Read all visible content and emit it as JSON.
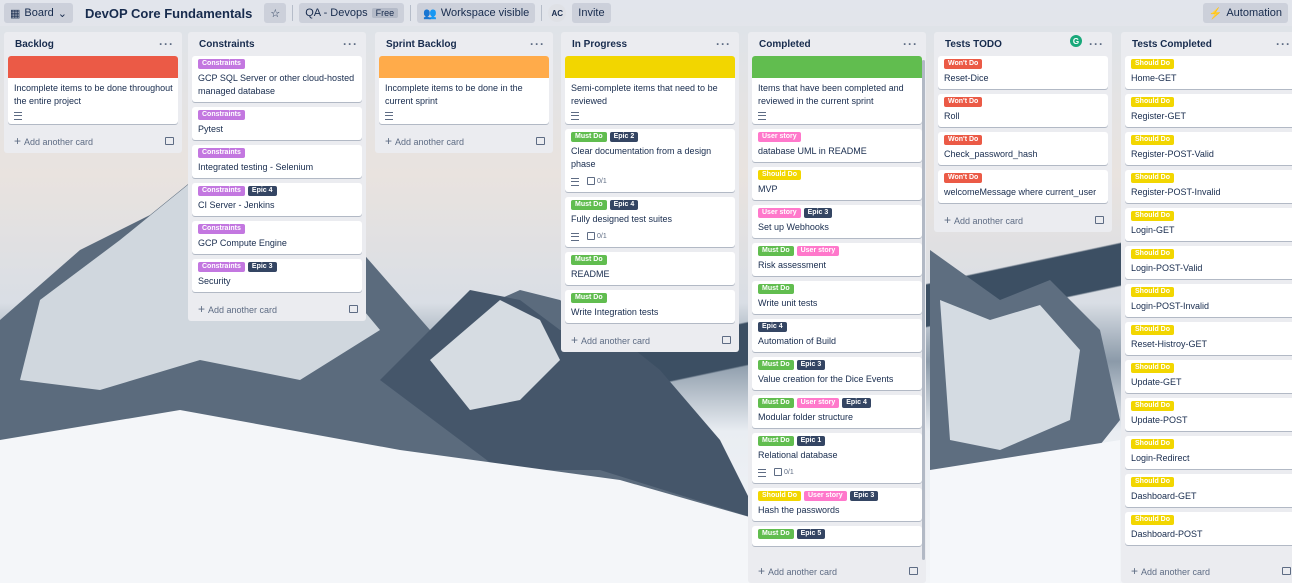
{
  "topbar": {
    "view_label": "Board",
    "board_title": "DevOP Core Fundamentals",
    "workspace_name": "QA - Devops",
    "plan_badge": "Free",
    "visibility_label": "Workspace visible",
    "member_initials": "AC",
    "invite_label": "Invite",
    "automation_label": "Automation"
  },
  "colors": {
    "green": "#61bd4f",
    "yellow": "#f2d600",
    "orange": "#ffab4a",
    "red": "#eb5a46",
    "purple": "#c377e0",
    "pink": "#ff78cb",
    "navy": "#344563"
  },
  "add_card_label": "Add another card",
  "lists": [
    {
      "title": "Backlog",
      "cards": [
        {
          "cover": "red",
          "title": "Incomplete items to be done throughout the entire project",
          "description": true
        }
      ]
    },
    {
      "title": "Constraints",
      "cards": [
        {
          "labels": [
            {
              "text": "Constraints",
              "color": "purple"
            }
          ],
          "title": "GCP SQL Server or other cloud-hosted managed database"
        },
        {
          "labels": [
            {
              "text": "Constraints",
              "color": "purple"
            }
          ],
          "title": "Pytest"
        },
        {
          "labels": [
            {
              "text": "Constraints",
              "color": "purple"
            }
          ],
          "title": "Integrated testing - Selenium"
        },
        {
          "labels": [
            {
              "text": "Constraints",
              "color": "purple"
            },
            {
              "text": "Epic 4",
              "color": "navy"
            }
          ],
          "title": "CI Server - Jenkins"
        },
        {
          "labels": [
            {
              "text": "Constraints",
              "color": "purple"
            }
          ],
          "title": "GCP Compute Engine"
        },
        {
          "labels": [
            {
              "text": "Constraints",
              "color": "purple"
            },
            {
              "text": "Epic 3",
              "color": "navy"
            }
          ],
          "title": "Security"
        }
      ]
    },
    {
      "title": "Sprint Backlog",
      "cards": [
        {
          "cover": "orange",
          "title": "Incomplete items to be done in the current sprint",
          "description": true
        }
      ]
    },
    {
      "title": "In Progress",
      "cards": [
        {
          "cover": "yellow",
          "title": "Semi-complete items that need to be reviewed",
          "description": true
        },
        {
          "labels": [
            {
              "text": "Must Do",
              "color": "green"
            },
            {
              "text": "Epic 2",
              "color": "navy"
            }
          ],
          "title": "Clear documentation from a design phase",
          "description": true,
          "checklist": "0/1"
        },
        {
          "labels": [
            {
              "text": "Must Do",
              "color": "green"
            },
            {
              "text": "Epic 4",
              "color": "navy"
            }
          ],
          "title": "Fully designed test suites",
          "description": true,
          "checklist": "0/1"
        },
        {
          "labels": [
            {
              "text": "Must Do",
              "color": "green"
            }
          ],
          "title": "README"
        },
        {
          "labels": [
            {
              "text": "Must Do",
              "color": "green"
            }
          ],
          "title": "Write Integration tests"
        }
      ]
    },
    {
      "title": "Completed",
      "cards": [
        {
          "cover": "green",
          "title": "Items that have been completed and reviewed in the current sprint",
          "description": true
        },
        {
          "labels": [
            {
              "text": "User story",
              "color": "pink"
            }
          ],
          "title": "database UML in README"
        },
        {
          "labels": [
            {
              "text": "Should Do",
              "color": "yellow"
            }
          ],
          "title": "MVP"
        },
        {
          "labels": [
            {
              "text": "User story",
              "color": "pink"
            },
            {
              "text": "Epic 3",
              "color": "navy"
            }
          ],
          "title": "Set up Webhooks"
        },
        {
          "labels": [
            {
              "text": "Must Do",
              "color": "green"
            },
            {
              "text": "User story",
              "color": "pink"
            }
          ],
          "title": "Risk assessment"
        },
        {
          "labels": [
            {
              "text": "Must Do",
              "color": "green"
            }
          ],
          "title": "Write unit tests"
        },
        {
          "labels": [
            {
              "text": "Epic 4",
              "color": "navy"
            }
          ],
          "title": "Automation of Build"
        },
        {
          "labels": [
            {
              "text": "Must Do",
              "color": "green"
            },
            {
              "text": "Epic 3",
              "color": "navy"
            }
          ],
          "title": "Value creation for the Dice Events"
        },
        {
          "labels": [
            {
              "text": "Must Do",
              "color": "green"
            },
            {
              "text": "User story",
              "color": "pink"
            },
            {
              "text": "Epic 4",
              "color": "navy"
            }
          ],
          "title": "Modular folder structure"
        },
        {
          "labels": [
            {
              "text": "Must Do",
              "color": "green"
            },
            {
              "text": "Epic 1",
              "color": "navy"
            }
          ],
          "title": "Relational database",
          "description": true,
          "checklist": "0/1"
        },
        {
          "labels": [
            {
              "text": "Should Do",
              "color": "yellow"
            },
            {
              "text": "User story",
              "color": "pink"
            },
            {
              "text": "Epic 3",
              "color": "navy"
            }
          ],
          "title": "Hash the passwords"
        },
        {
          "labels": [
            {
              "text": "Must Do",
              "color": "green"
            },
            {
              "text": "Epic 5",
              "color": "navy"
            }
          ],
          "title": ""
        }
      ]
    },
    {
      "title": "Tests TODO",
      "cards": [
        {
          "labels": [
            {
              "text": "Won't Do",
              "color": "red"
            }
          ],
          "title": "Reset-Dice"
        },
        {
          "labels": [
            {
              "text": "Won't Do",
              "color": "red"
            }
          ],
          "title": "Roll"
        },
        {
          "labels": [
            {
              "text": "Won't Do",
              "color": "red"
            }
          ],
          "title": "Check_password_hash"
        },
        {
          "labels": [
            {
              "text": "Won't Do",
              "color": "red"
            }
          ],
          "title": "welcomeMessage where current_user"
        }
      ]
    },
    {
      "title": "Tests Completed",
      "cards": [
        {
          "labels": [
            {
              "text": "Should Do",
              "color": "yellow"
            }
          ],
          "title": "Home-GET"
        },
        {
          "labels": [
            {
              "text": "Should Do",
              "color": "yellow"
            }
          ],
          "title": "Register-GET"
        },
        {
          "labels": [
            {
              "text": "Should Do",
              "color": "yellow"
            }
          ],
          "title": "Register-POST-Valid"
        },
        {
          "labels": [
            {
              "text": "Should Do",
              "color": "yellow"
            }
          ],
          "title": "Register-POST-Invalid"
        },
        {
          "labels": [
            {
              "text": "Should Do",
              "color": "yellow"
            }
          ],
          "title": "Login-GET"
        },
        {
          "labels": [
            {
              "text": "Should Do",
              "color": "yellow"
            }
          ],
          "title": "Login-POST-Valid"
        },
        {
          "labels": [
            {
              "text": "Should Do",
              "color": "yellow"
            }
          ],
          "title": "Login-POST-Invalid"
        },
        {
          "labels": [
            {
              "text": "Should Do",
              "color": "yellow"
            }
          ],
          "title": "Reset-Histroy-GET"
        },
        {
          "labels": [
            {
              "text": "Should Do",
              "color": "yellow"
            }
          ],
          "title": "Update-GET"
        },
        {
          "labels": [
            {
              "text": "Should Do",
              "color": "yellow"
            }
          ],
          "title": "Update-POST"
        },
        {
          "labels": [
            {
              "text": "Should Do",
              "color": "yellow"
            }
          ],
          "title": "Login-Redirect"
        },
        {
          "labels": [
            {
              "text": "Should Do",
              "color": "yellow"
            }
          ],
          "title": "Dashboard-GET"
        },
        {
          "labels": [
            {
              "text": "Should Do",
              "color": "yellow"
            }
          ],
          "title": "Dashboard-POST"
        }
      ]
    }
  ]
}
